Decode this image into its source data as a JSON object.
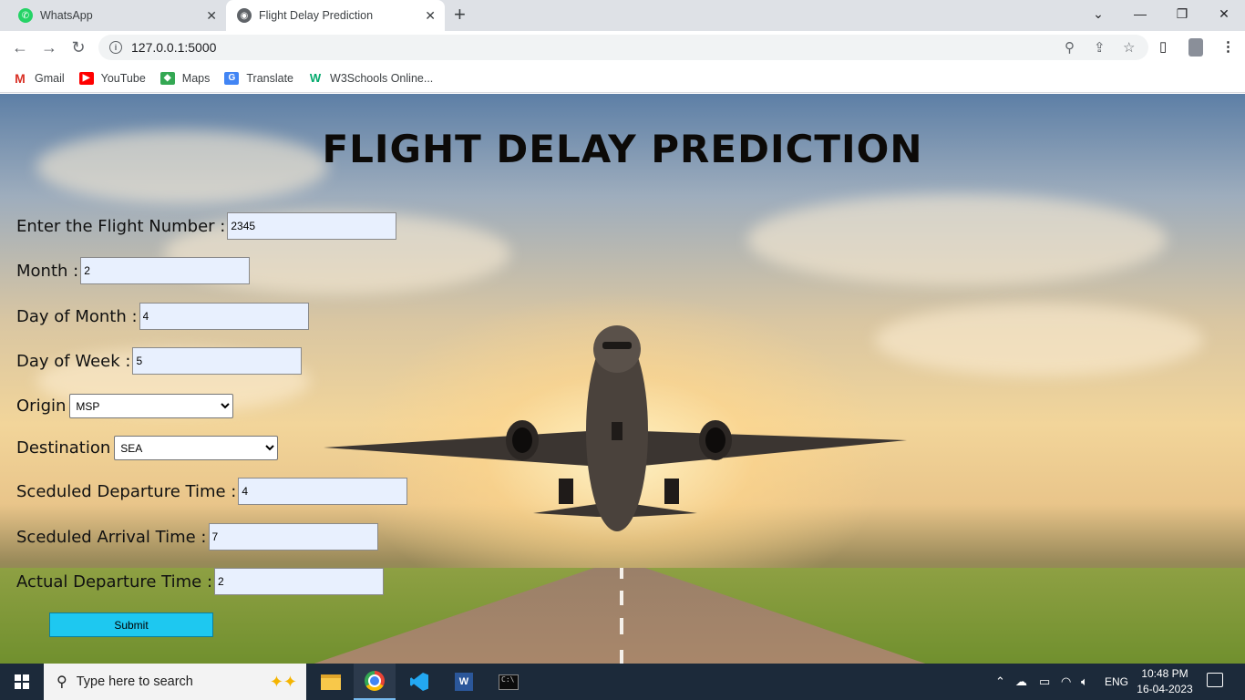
{
  "browser": {
    "tabs": [
      {
        "label": "WhatsApp",
        "active": false
      },
      {
        "label": "Flight Delay Prediction",
        "active": true
      }
    ],
    "url": "127.0.0.1:5000",
    "bookmarks": [
      {
        "label": "Gmail",
        "icon": "gmail-icon"
      },
      {
        "label": "YouTube",
        "icon": "youtube-icon"
      },
      {
        "label": "Maps",
        "icon": "maps-icon"
      },
      {
        "label": "Translate",
        "icon": "translate-icon"
      },
      {
        "label": "W3Schools Online...",
        "icon": "w3schools-icon"
      }
    ]
  },
  "page": {
    "title": "FLIGHT DELAY PREDICTION",
    "form": {
      "flight_number": {
        "label": "Enter the Flight Number :",
        "value": "2345"
      },
      "month": {
        "label": "Month :",
        "value": "2"
      },
      "day_of_month": {
        "label": "Day of Month :",
        "value": "4"
      },
      "day_of_week": {
        "label": "Day of Week :",
        "value": "5"
      },
      "origin": {
        "label": "Origin",
        "selected": "MSP"
      },
      "destination": {
        "label": "Destination",
        "selected": "SEA"
      },
      "sched_departure": {
        "label": "Sceduled Departure Time :",
        "value": "4"
      },
      "sched_arrival": {
        "label": "Sceduled Arrival Time :",
        "value": "7"
      },
      "actual_departure": {
        "label": "Actual Departure Time :",
        "value": "2"
      },
      "submit_label": "Submit"
    }
  },
  "taskbar": {
    "search_placeholder": "Type here to search",
    "language": "ENG",
    "time": "10:48 PM",
    "date": "16-04-2023"
  },
  "colors": {
    "submit_bg": "#1ec8f0",
    "input_bg": "#e8f0fe",
    "taskbar_bg": "#1c2a3a"
  }
}
